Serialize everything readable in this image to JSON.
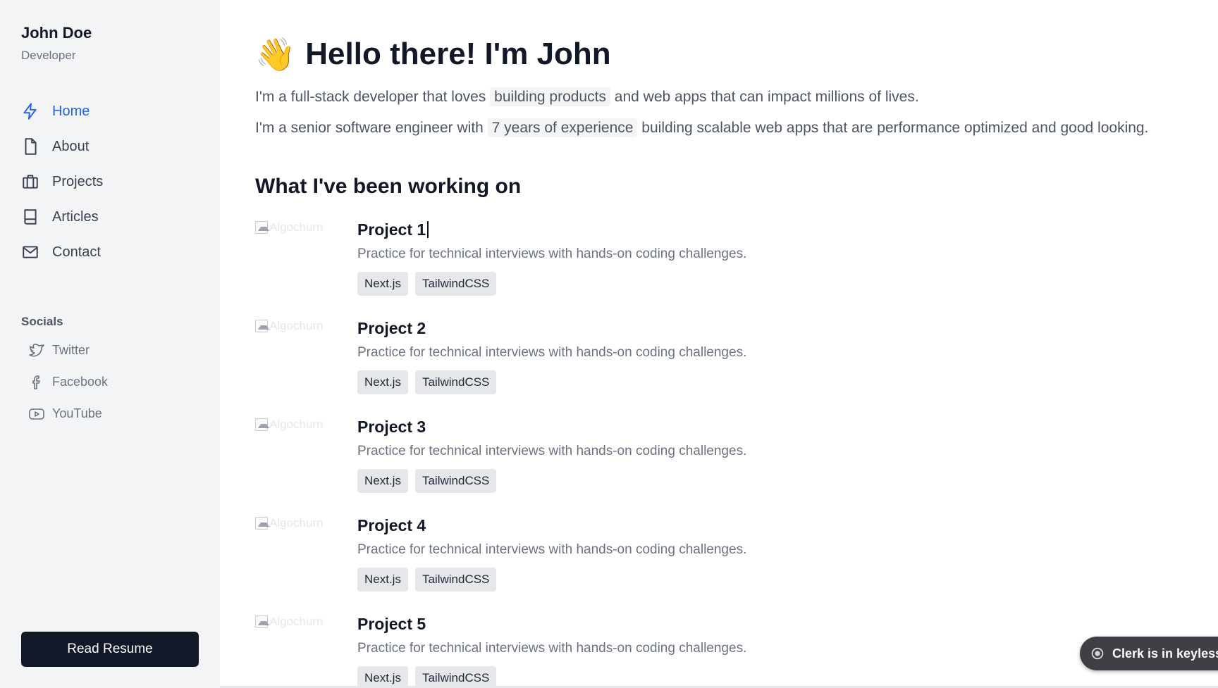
{
  "profile": {
    "name": "John Doe",
    "role": "Developer"
  },
  "nav": {
    "items": [
      {
        "label": "Home",
        "icon": "lightning-icon"
      },
      {
        "label": "About",
        "icon": "document-icon"
      },
      {
        "label": "Projects",
        "icon": "briefcase-icon"
      },
      {
        "label": "Articles",
        "icon": "book-icon"
      },
      {
        "label": "Contact",
        "icon": "mail-icon"
      }
    ],
    "active": "Home"
  },
  "socials": {
    "title": "Socials",
    "items": [
      {
        "label": "Twitter",
        "icon": "twitter-icon"
      },
      {
        "label": "Facebook",
        "icon": "facebook-icon"
      },
      {
        "label": "YouTube",
        "icon": "youtube-icon"
      }
    ]
  },
  "resume_button": "Read Resume",
  "hero": {
    "emoji": "👋",
    "title": "Hello there! I'm John",
    "intro1_before": "I'm a full-stack developer that loves ",
    "intro1_highlight": "building products",
    "intro1_after": " and web apps that can impact millions of lives.",
    "intro2_before": "I'm a senior software engineer with ",
    "intro2_highlight": "7 years of experience",
    "intro2_after": " building scalable web apps that are performance optimized and good looking."
  },
  "work_section_title": "What I've been working on",
  "projects": [
    {
      "image_alt": "Algochurn",
      "title": "Project 1",
      "description": "Practice for technical interviews with hands-on coding challenges.",
      "tags": [
        "Next.js",
        "TailwindCSS"
      ]
    },
    {
      "image_alt": "Algochurn",
      "title": "Project 2",
      "description": "Practice for technical interviews with hands-on coding challenges.",
      "tags": [
        "Next.js",
        "TailwindCSS"
      ]
    },
    {
      "image_alt": "Algochurn",
      "title": "Project 3",
      "description": "Practice for technical interviews with hands-on coding challenges.",
      "tags": [
        "Next.js",
        "TailwindCSS"
      ]
    },
    {
      "image_alt": "Algochurn",
      "title": "Project 4",
      "description": "Practice for technical interviews with hands-on coding challenges.",
      "tags": [
        "Next.js",
        "TailwindCSS"
      ]
    },
    {
      "image_alt": "Algochurn",
      "title": "Project 5",
      "description": "Practice for technical interviews with hands-on coding challenges.",
      "tags": [
        "Next.js",
        "TailwindCSS"
      ]
    }
  ],
  "toast": {
    "text": "Clerk is in keyless m",
    "icon": "clerk-icon"
  },
  "colors": {
    "accent": "#2563eb",
    "sidebar_bg": "#f3f4f6",
    "button_bg": "#111827"
  }
}
